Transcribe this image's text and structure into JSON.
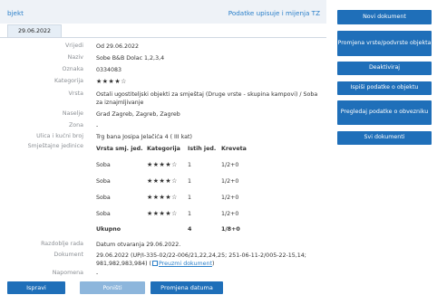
{
  "header": {
    "title": "bjekt",
    "link": "Podatke upisuje i mijenja TZ"
  },
  "tab": {
    "label": "29.06.2022"
  },
  "fields": {
    "vrijedi": {
      "label": "Vrijedi",
      "value": "Od 29.06.2022"
    },
    "naziv": {
      "label": "Naziv",
      "value": "Sobe B&B Dolac 1,2,3,4"
    },
    "oznaka": {
      "label": "Oznaka",
      "value": "0334083"
    },
    "kategorija": {
      "label": "Kategorija",
      "value": "★★★★☆"
    },
    "vrsta": {
      "label": "Vrsta",
      "value": "Ostali ugostiteljski objekti za smještaj (Druge vrste - skupina kampovi) / Soba za iznajmljivanje"
    },
    "naselje": {
      "label": "Naselje",
      "value": "Grad Zagreb, Zagreb, Zagreb"
    },
    "zona": {
      "label": "Zona",
      "value": "-"
    },
    "ulica": {
      "label": "Ulica i kućni broj",
      "value": "Trg bana Josipa Jelačića 4 ( III kat)"
    },
    "smjestajne": {
      "label": "Smještajne jedinice"
    },
    "razdoblje": {
      "label": "Razdoblje rada",
      "value": "Datum otvaranja 29.06.2022."
    },
    "dokument": {
      "label": "Dokument",
      "value": "29.06.2022 (UP/I-335-02/22-006/21,22,24,25; 251-06-11-2/005-22-15,14; 981,982,983,984) (",
      "link": "Preuzmi dokument",
      "suffix": ")"
    },
    "napomena": {
      "label": "Napomena",
      "value": "-"
    }
  },
  "units_table": {
    "headers": [
      "Vrsta smj. jed.",
      "Kategorija",
      "Istih jed.",
      "Kreveta"
    ],
    "rows": [
      [
        "Soba",
        "★★★★☆",
        "1",
        "1/2+0"
      ],
      [
        "Soba",
        "★★★★☆",
        "1",
        "1/2+0"
      ],
      [
        "Soba",
        "★★★★☆",
        "1",
        "1/2+0"
      ],
      [
        "Soba",
        "★★★★☆",
        "1",
        "1/2+0"
      ]
    ],
    "total": [
      "Ukupno",
      "",
      "4",
      "1/8+0"
    ]
  },
  "buttons": {
    "ispravi": "Ispravi",
    "ponisti": "Poništi",
    "promjena_datuma": "Promjena datuma"
  },
  "sidebar": [
    "Novi dokument",
    "Promjena vrste/podvrste objekta",
    "Deaktiviraj",
    "Ispiši podatke o objektu",
    "Pregledaj podatke o obvezniku",
    "Svi dokumenti"
  ]
}
